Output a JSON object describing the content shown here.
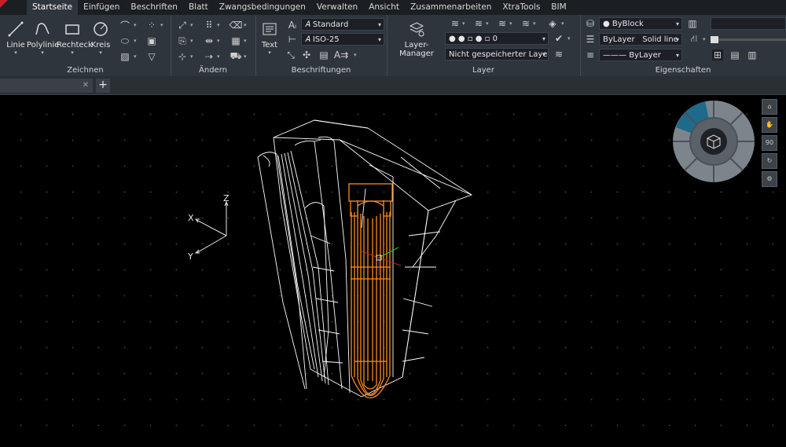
{
  "menu": {
    "tabs": [
      "Startseite",
      "Einfügen",
      "Beschriften",
      "Blatt",
      "Zwangsbedingungen",
      "Verwalten",
      "Ansicht",
      "Zusammenarbeiten",
      "XtraTools",
      "BIM"
    ],
    "active": "Startseite"
  },
  "ribbon": {
    "zeichnen": {
      "label": "Zeichnen",
      "tools": [
        "Linie",
        "Polylinie",
        "Rechteck",
        "Kreis"
      ]
    },
    "aendern": {
      "label": "Ändern"
    },
    "beschriftungen": {
      "label": "Beschriftungen",
      "text_tool": "Text",
      "text_style": "Standard",
      "dim_style": "ISO-25"
    },
    "layer": {
      "label": "Layer",
      "manager": "Layer-Manager",
      "current_layer": "0",
      "layer_state": "Nicht gespeicherter Layer-St"
    },
    "eigenschaften": {
      "label": "Eigenschaften",
      "color": "ByBlock",
      "linetype_layer": "ByLayer",
      "linetype": "Solid line",
      "lineweight": "ByLayer"
    }
  },
  "filetabs": {
    "new_tab": "+"
  },
  "axes": {
    "x": "X",
    "y": "Y",
    "z": "Z"
  },
  "viewcube": {
    "zoom_label": "90"
  },
  "colors": {
    "ribbon_bg": "#2f353d",
    "canvas_bg": "#000000",
    "selection": "#ff8c1a",
    "wire": "#ffffff",
    "accent": "#1d6a8a"
  }
}
